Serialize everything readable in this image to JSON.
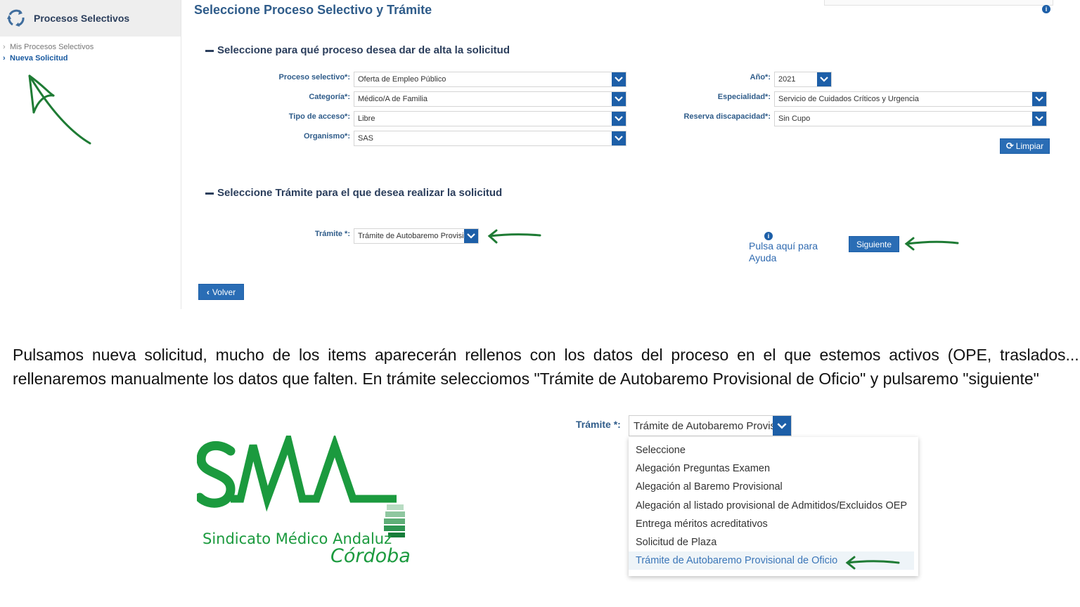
{
  "sidebar": {
    "title": "Procesos Selectivos",
    "items": [
      {
        "label": "Mis Procesos Selectivos",
        "active": false
      },
      {
        "label": "Nueva Solicitud",
        "active": true
      }
    ]
  },
  "main": {
    "page_title": "Seleccione Proceso Selectivo y Trámite",
    "section1_title": "Seleccione para qué proceso desea dar de alta la solicitud",
    "fields_left": [
      {
        "label": "Proceso selectivo*:",
        "value": "Oferta de Empleo Público"
      },
      {
        "label": "Categoría*:",
        "value": "Médico/A de Familia"
      },
      {
        "label": "Tipo de acceso*:",
        "value": "Libre"
      },
      {
        "label": "Organismo*:",
        "value": "SAS"
      }
    ],
    "fields_right": [
      {
        "label": "Año*:",
        "value": "2021"
      },
      {
        "label": "Especialidad*:",
        "value": "Servicio de Cuidados Críticos y Urgencia"
      },
      {
        "label": "Reserva discapacidad*:",
        "value": "Sin Cupo"
      }
    ],
    "limpiar_label": "Limpiar",
    "section2_title": "Seleccione Trámite para el que desea realizar la solicitud",
    "tramite_label": "Trámite *:",
    "tramite_value": "Trámite de Autobaremo Provisi",
    "help_text_1": "Pulsa aquí para",
    "help_text_2": "Ayuda",
    "siguiente_label": "Siguiente",
    "volver_label": "Volver"
  },
  "description": {
    "text": "Pulsamos nueva solicitud, mucho de los items aparecerán rellenos con los datos del proceso en el que estemos activos (OPE, traslados... y rellenaremos manualmente los datos que falten. En trámite selecciomos \"Trámite de Autobaremo Provisional de Oficio\" y pulsaremo \"siguiente\""
  },
  "logo": {
    "letters": "SMA",
    "line1": "Sindicato Médico Andaluz",
    "line2": "Córdoba"
  },
  "dropdown": {
    "label": "Trámite *:",
    "value": "Trámite de Autobaremo Provisi",
    "options": [
      "Seleccione",
      "Alegación Preguntas Examen",
      "Alegación al Baremo Provisional",
      "Alegación al listado provisional de Admitidos/Excluidos OEP",
      "Entrega méritos acreditativos",
      "Solicitud de Plaza",
      "Trámite de Autobaremo Provisional de Oficio"
    ],
    "selected_index": 6
  },
  "colors": {
    "primary": "#1d5fa8",
    "title": "#2f5c8a",
    "annotation": "#1e7b34",
    "logo_green": "#1b9a3e"
  }
}
